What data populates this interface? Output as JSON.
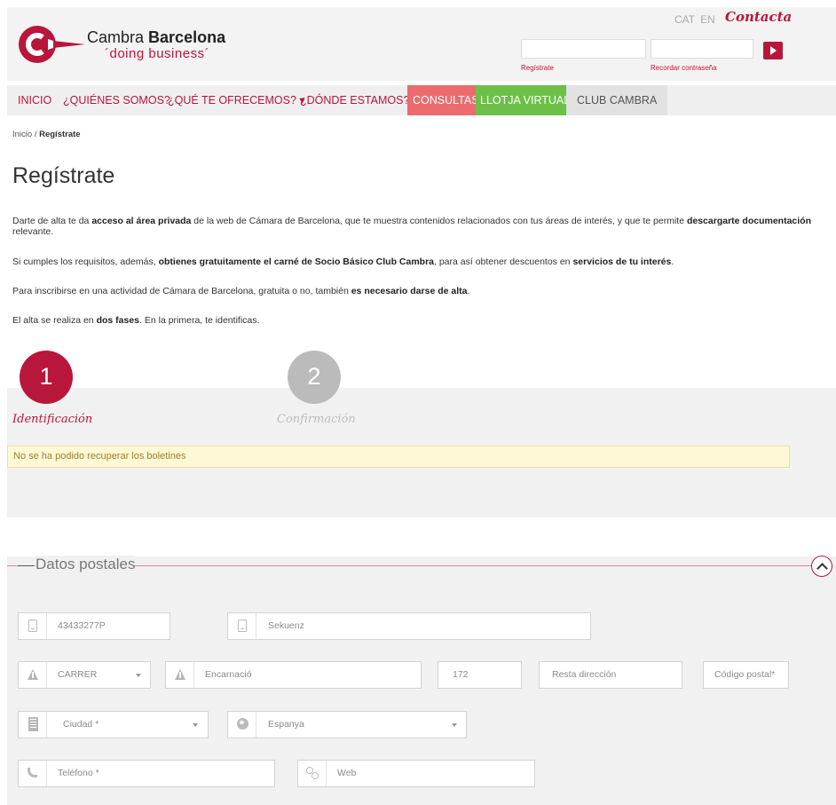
{
  "header": {
    "logo_name_regular": "Cambra",
    "logo_name_bold": "Barcelona",
    "logo_tagline": "´doing business´",
    "lang_cat": "CAT",
    "lang_en": "EN",
    "contact_label": "Contacta",
    "register_link": "Regístrate",
    "recover_link": "Recordar contraseña",
    "brand_color": "#b8163a"
  },
  "nav": {
    "items": [
      {
        "label": "INICIO"
      },
      {
        "label": "¿QUIÉNES SOMOS?"
      },
      {
        "label": "¿QUÉ TE OFRECEMOS? ▾"
      },
      {
        "label": "¿DÓNDE ESTAMOS?"
      },
      {
        "label": "CONSULTAS"
      },
      {
        "label": "LLOTJA VIRTUAL"
      },
      {
        "label": "CLUB CAMBRA"
      }
    ],
    "consultas_color": "#ec6b6e",
    "llotja_color": "#6cc048"
  },
  "breadcrumb": {
    "home": "Inicio",
    "sep": " / ",
    "current": "Regístrate"
  },
  "page": {
    "title": "Regístrate",
    "p1_a": "Darte de alta te da ",
    "p1_b": "acceso al área privada",
    "p1_c": " de la web de Cámara de Barcelona, que te muestra contenidos relacionados con tus áreas de interés, y que te permite ",
    "p1_d": "descargarte documentación",
    "p1_e": " relevante.",
    "p2_a": "Si cumples los requisitos, además, ",
    "p2_b": "obtienes gratuitamente el carné de Socio Básico Club Cambra",
    "p2_c": ", para así obtener descuentos en ",
    "p2_d": "servicios de tu interés",
    "p2_e": ".",
    "p3_a": "Para inscribirse en una actividad de Cámara de Barcelona, gratuita o no, también ",
    "p3_b": "es necesario darse de alta",
    "p3_c": ".",
    "p4_a": "El alta se realiza en ",
    "p4_b": "dos fases",
    "p4_c": ". En la primera, te identificas."
  },
  "steps": [
    {
      "number": "1",
      "label": "Identificación",
      "state": "active"
    },
    {
      "number": "2",
      "label": "Confirmación",
      "state": "inactive"
    }
  ],
  "warning": "No se ha podido recuperar los boletines",
  "form": {
    "section_title": "Datos postales",
    "nif_value": "43433277P",
    "company_value": "Sekuenz",
    "street_type_value": "CARRER",
    "street_value": "Encarnació",
    "number_value": "172",
    "address_rest_placeholder": "Resta dirección",
    "postal_code_placeholder": "Código postal*",
    "city_placeholder": "Ciudad *",
    "country_value": "Espanya",
    "phone_placeholder": "Teléfono *",
    "web_placeholder": "Web"
  }
}
